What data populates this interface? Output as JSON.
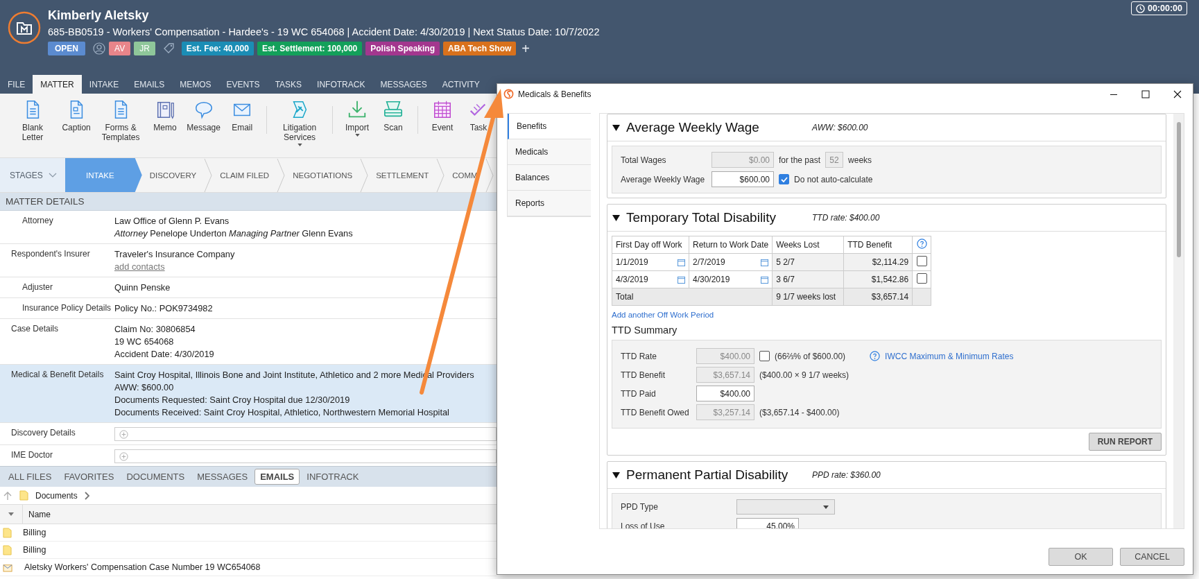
{
  "header": {
    "client_name": "Kimberly Aletsky",
    "subtitle": "685-BB0519 - Workers' Compensation - Hardee's - 19 WC 654068 | Accident Date: 4/30/2019 | Next Status Date: 10/7/2022",
    "status": "OPEN",
    "timer": "00:00:00",
    "staff": [
      {
        "initials": "AV",
        "color": "#e8858a"
      },
      {
        "initials": "JR",
        "color": "#8fc79a"
      }
    ],
    "tags": [
      {
        "label": "Est. Fee: 40,000",
        "color": "#1b8db5"
      },
      {
        "label": "Est. Settlement: 100,000",
        "color": "#13a05a"
      },
      {
        "label": "Polish Speaking",
        "color": "#a3378e"
      },
      {
        "label": "ABA Tech Show",
        "color": "#d8711c"
      }
    ],
    "add_tag": "+"
  },
  "menu_tabs": [
    {
      "label": "FILE",
      "selected": false
    },
    {
      "label": "MATTER",
      "selected": true
    },
    {
      "label": "INTAKE",
      "selected": false
    },
    {
      "label": "EMAILS",
      "selected": false
    },
    {
      "label": "MEMOS",
      "selected": false
    },
    {
      "label": "EVENTS",
      "selected": false
    },
    {
      "label": "TASKS",
      "selected": false
    },
    {
      "label": "INFOTRACK",
      "selected": false
    },
    {
      "label": "MESSAGES",
      "selected": false
    },
    {
      "label": "ACTIVITY",
      "selected": false
    }
  ],
  "toolbar_groups": [
    [
      {
        "label": "Blank Letter",
        "kind": "document",
        "dropdown": false
      },
      {
        "label": "Caption",
        "kind": "caption",
        "dropdown": false
      },
      {
        "label": "Forms & Templates",
        "kind": "document",
        "dropdown": false
      },
      {
        "label": "Memo",
        "kind": "memo",
        "dropdown": false
      },
      {
        "label": "Message",
        "kind": "message",
        "dropdown": false
      },
      {
        "label": "Email",
        "kind": "email",
        "dropdown": false
      }
    ],
    [
      {
        "label": "Litigation Services",
        "kind": "litigation",
        "dropdown": true
      }
    ],
    [
      {
        "label": "Import",
        "kind": "import",
        "dropdown": true
      },
      {
        "label": "Scan",
        "kind": "scan",
        "dropdown": false
      }
    ],
    [
      {
        "label": "Event",
        "kind": "event",
        "dropdown": false
      },
      {
        "label": "Task",
        "kind": "task",
        "dropdown": false
      }
    ]
  ],
  "stages_button": "STAGES",
  "stages": [
    {
      "label": "INTAKE",
      "selected": true
    },
    {
      "label": "DISCOVERY",
      "selected": false
    },
    {
      "label": "CLAIM FILED",
      "selected": false
    },
    {
      "label": "NEGOTIATIONS",
      "selected": false
    },
    {
      "label": "SETTLEMENT",
      "selected": false
    },
    {
      "label": "COMM",
      "selected": false
    }
  ],
  "matter_details": {
    "title": "MATTER DETAILS",
    "rows": [
      {
        "label": "Attorney",
        "indented": true,
        "selected": false,
        "kind": "text",
        "lines": [
          {
            "kind": "text",
            "text": "Law Office of Glenn P. Evans"
          },
          {
            "kind": "text",
            "text": "*Attorney* Penelope Underton *Managing Partner* Glenn Evans"
          }
        ]
      },
      {
        "label": "Respondent's Insurer",
        "indented": false,
        "selected": false,
        "kind": "text",
        "lines": [
          {
            "kind": "text",
            "text": "Traveler's Insurance Company"
          },
          {
            "kind": "link",
            "text": "add contacts"
          }
        ]
      },
      {
        "label": "Adjuster",
        "indented": true,
        "selected": false,
        "kind": "text",
        "lines": [
          {
            "kind": "text",
            "text": "Quinn Penske"
          }
        ]
      },
      {
        "label": "Insurance Policy Details",
        "indented": true,
        "selected": false,
        "kind": "text",
        "lines": [
          {
            "kind": "text",
            "text": "Policy No.: POK9734982"
          }
        ]
      },
      {
        "label": "Case Details",
        "indented": false,
        "selected": false,
        "kind": "text",
        "lines": [
          {
            "kind": "text",
            "text": "Claim No: 30806854"
          },
          {
            "kind": "text",
            "text": "19 WC 654068"
          },
          {
            "kind": "text",
            "text": "Accident Date: 4/30/2019"
          }
        ]
      },
      {
        "label": "Medical & Benefit Details",
        "indented": false,
        "selected": true,
        "kind": "text",
        "lines": [
          {
            "kind": "text",
            "text": "Saint Croy Hospital, Illinois Bone and Joint Institute, Athletico and 2 more Medical Providers"
          },
          {
            "kind": "text",
            "text": "AWW: $600.00"
          },
          {
            "kind": "text",
            "text": "Documents Requested: Saint Croy Hospital due 12/30/2019"
          },
          {
            "kind": "text",
            "text": "Documents Received: Saint Croy Hospital, Athletico, Northwestern Memorial Hospital"
          }
        ]
      },
      {
        "label": "Discovery Details",
        "indented": false,
        "selected": false,
        "kind": "field",
        "lines": []
      },
      {
        "label": "IME Doctor",
        "indented": false,
        "selected": false,
        "kind": "field",
        "lines": []
      }
    ]
  },
  "file_tabs": [
    {
      "label": "ALL FILES",
      "selected": false
    },
    {
      "label": "FAVORITES",
      "selected": false
    },
    {
      "label": "DOCUMENTS",
      "selected": false
    },
    {
      "label": "MESSAGES",
      "selected": false
    },
    {
      "label": "EMAILS",
      "selected": true
    },
    {
      "label": "INFOTRACK",
      "selected": false
    }
  ],
  "breadcrumb": "Documents",
  "file_columns": [
    "Name"
  ],
  "files": [
    {
      "name": "Billing",
      "kind": "folder"
    },
    {
      "name": "Billing",
      "kind": "folder"
    },
    {
      "name": "Aletsky Workers' Compensation Case Number 19 WC654068",
      "kind": "email"
    }
  ],
  "dialog": {
    "title": "Medicals & Benefits",
    "side_tabs": [
      {
        "label": "Benefits",
        "selected": true
      },
      {
        "label": "Medicals",
        "selected": false
      },
      {
        "label": "Balances",
        "selected": false
      },
      {
        "label": "Reports",
        "selected": false
      }
    ],
    "aww": {
      "title": "Average Weekly Wage",
      "rate": "AWW: $600.00",
      "total_wages_label": "Total Wages",
      "total_wages": "$0.00",
      "for_the_past": "for the past",
      "weeks_count": "52",
      "weeks": "weeks",
      "aww_label": "Average Weekly Wage",
      "aww_value": "$600.00",
      "auto_calc_label": "Do not auto-calculate",
      "auto_calc_checked": true
    },
    "ttd": {
      "title": "Temporary Total Disability",
      "rate": "TTD rate: $400.00",
      "columns": [
        "First Day off Work",
        "Return to Work Date",
        "Weeks Lost",
        "TTD Benefit"
      ],
      "rows": [
        {
          "first_day": "1/1/2019",
          "return_date": "2/7/2019",
          "weeks_lost": "5 2/7",
          "benefit": "$2,114.29",
          "checked": false
        },
        {
          "first_day": "4/3/2019",
          "return_date": "4/30/2019",
          "weeks_lost": "3 6/7",
          "benefit": "$1,542.86",
          "checked": false
        }
      ],
      "total": {
        "label": "Total",
        "weeks": "9 1/7 weeks lost",
        "benefit": "$3,657.14"
      },
      "add_link": "Add another Off Work Period",
      "summary_title": "TTD Summary",
      "summary": [
        {
          "label": "TTD Rate",
          "value": "$400.00",
          "editable": false,
          "has_checkbox": true,
          "checked": false,
          "note": "(66⅔% of $600.00)",
          "link": "IWCC Maximum & Minimum Rates"
        },
        {
          "label": "TTD Benefit",
          "value": "$3,657.14",
          "editable": false,
          "has_checkbox": false,
          "note": "($400.00 × 9 1/7 weeks)"
        },
        {
          "label": "TTD Paid",
          "value": "$400.00",
          "editable": true,
          "has_checkbox": false
        },
        {
          "label": "TTD Benefit Owed",
          "value": "$3,257.14",
          "editable": false,
          "has_checkbox": false,
          "note": "($3,657.14 - $400.00)"
        }
      ],
      "run_report": "RUN REPORT"
    },
    "ppd": {
      "title": "Permanent Partial Disability",
      "rate": "PPD rate: $360.00",
      "type_label": "PPD Type",
      "loss_label": "Loss of Use",
      "loss_value": "45.00%"
    },
    "buttons": [
      "OK",
      "CANCEL"
    ]
  }
}
